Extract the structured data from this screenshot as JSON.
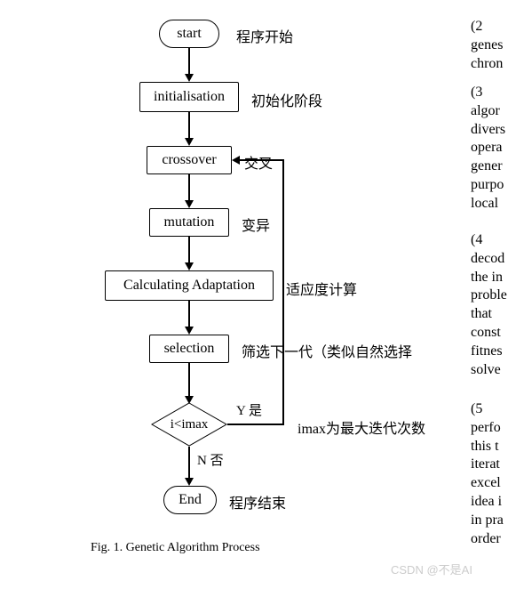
{
  "flow": {
    "start": {
      "label": "start",
      "note": "程序开始"
    },
    "init": {
      "label": "initialisation",
      "note": "初始化阶段"
    },
    "crossover": {
      "label": "crossover",
      "note": "交叉"
    },
    "mutation": {
      "label": "mutation",
      "note": "变异"
    },
    "calc": {
      "label": "Calculating Adaptation",
      "note": "适应度计算"
    },
    "selection": {
      "label": "selection",
      "note": "筛选下一代（类似自然选择"
    },
    "decision": {
      "label": "i<imax",
      "yes": "Y 是",
      "no": "N 否",
      "note": "imax为最大迭代次数"
    },
    "end": {
      "label": "End",
      "note": "程序结束"
    }
  },
  "caption": "Fig. 1.   Genetic Algorithm Process",
  "side_text": [
    "(2",
    "genes",
    "chron",
    "(3",
    "algor",
    "divers",
    "opera",
    "gener",
    "purpo",
    "local",
    "(4",
    "decod",
    "the in",
    "proble",
    "that",
    "const",
    "fitnes",
    "solve",
    "(5",
    "perfo",
    "this t",
    "iterat",
    "excel",
    "idea i",
    "in pra",
    "order"
  ],
  "watermark": "CSDN @不是AI"
}
